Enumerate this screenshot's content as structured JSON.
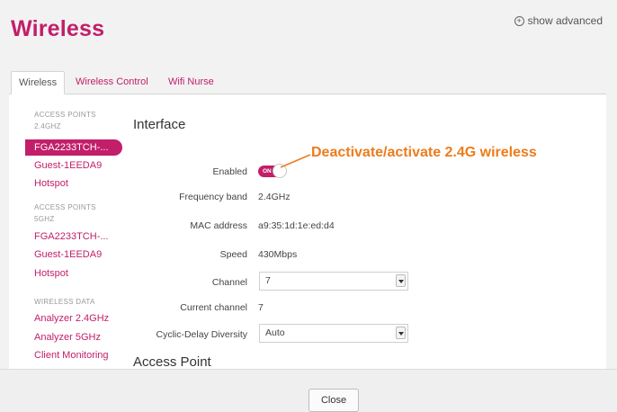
{
  "header": {
    "title": "Wireless",
    "show_advanced": "show advanced"
  },
  "tabs": [
    {
      "label": "Wireless",
      "active": true
    },
    {
      "label": "Wireless Control",
      "active": false
    },
    {
      "label": "Wifi Nurse",
      "active": false
    }
  ],
  "sidebar": {
    "groups": [
      {
        "header_line1": "ACCESS POINTS",
        "header_line2": "2.4GHZ",
        "items": [
          {
            "label": "FGA2233TCH-...",
            "selected": true
          },
          {
            "label": "Guest-1EEDA9",
            "selected": false
          },
          {
            "label": "Hotspot",
            "selected": false
          }
        ]
      },
      {
        "header_line1": "ACCESS POINTS",
        "header_line2": "5GHZ",
        "items": [
          {
            "label": "FGA2233TCH-...",
            "selected": false
          },
          {
            "label": "Guest-1EEDA9",
            "selected": false
          },
          {
            "label": "Hotspot",
            "selected": false
          }
        ]
      },
      {
        "header_line1": "WIRELESS DATA",
        "items": [
          {
            "label": "Analyzer 2.4GHz",
            "selected": false
          },
          {
            "label": "Analyzer 5GHz",
            "selected": false
          },
          {
            "label": "Client Monitoring",
            "selected": false
          }
        ]
      }
    ]
  },
  "interface": {
    "title": "Interface",
    "enabled_label": "Enabled",
    "enabled_toggle": "ON",
    "frequency_label": "Frequency band",
    "frequency_value": "2.4GHz",
    "mac_label": "MAC address",
    "mac_value": "a9:35:1d:1e:ed:d4",
    "speed_label": "Speed",
    "speed_value": "430Mbps",
    "channel_label": "Channel",
    "channel_value": "7",
    "current_channel_label": "Current channel",
    "current_channel_value": "7",
    "cdd_label": "Cyclic-Delay Diversity",
    "cdd_value": "Auto"
  },
  "access_point": {
    "title": "Access Point"
  },
  "annotation": "Deactivate/activate 2.4G wireless",
  "footer": {
    "close_label": "Close"
  },
  "colors": {
    "accent": "#c21e6a",
    "annotation": "#ec7c1c"
  }
}
